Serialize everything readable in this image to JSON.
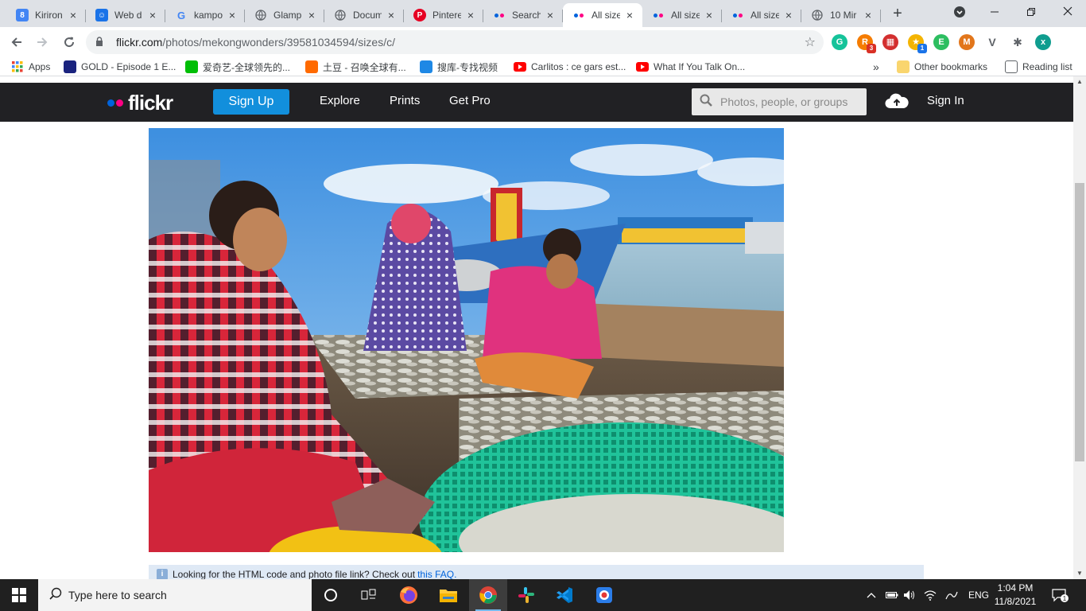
{
  "browser": {
    "tabs": [
      {
        "title": "Kiriron",
        "favicon": "google-sites-icon",
        "active": false
      },
      {
        "title": "Web d",
        "favicon": "google-contacts-icon",
        "active": false
      },
      {
        "title": "kampo",
        "favicon": "google-g-icon",
        "active": false
      },
      {
        "title": "Glamp",
        "favicon": "globe-icon",
        "active": false
      },
      {
        "title": "Docum",
        "favicon": "globe-icon",
        "active": false
      },
      {
        "title": "Pintere",
        "favicon": "pinterest-icon",
        "active": false
      },
      {
        "title": "Search",
        "favicon": "flickr-icon",
        "active": false
      },
      {
        "title": "All size",
        "favicon": "flickr-icon",
        "active": true
      },
      {
        "title": "All size",
        "favicon": "flickr-icon",
        "active": false
      },
      {
        "title": "All size",
        "favicon": "flickr-icon",
        "active": false
      },
      {
        "title": "10 Mir",
        "favicon": "globe-icon",
        "active": false
      }
    ],
    "url_host": "flickr.com",
    "url_path": "/photos/mekongwonders/39581034594/sizes/c/",
    "extensions": [
      {
        "name": "grammarly-icon",
        "color": "#15c39a",
        "label": "G",
        "badge": ""
      },
      {
        "name": "rss-extension-icon",
        "color": "#f57c00",
        "label": "R",
        "badge": "3"
      },
      {
        "name": "red-grid-extension-icon",
        "color": "#d32f2f",
        "label": "▦",
        "badge": ""
      },
      {
        "name": "star-extension-icon",
        "color": "#f4b400",
        "label": "★",
        "badge": "1"
      },
      {
        "name": "evernote-icon",
        "color": "#2dbe60",
        "label": "E",
        "badge": ""
      },
      {
        "name": "metamask-icon",
        "color": "#e2761b",
        "label": "M",
        "badge": ""
      },
      {
        "name": "vee-extension-icon",
        "color": "#5f6368",
        "label": "V",
        "badge": ""
      },
      {
        "name": "puzzle-extensions-icon",
        "color": "#5f6368",
        "label": "✱",
        "badge": ""
      },
      {
        "name": "profile-avatar-icon",
        "color": "#0f9d8f",
        "label": "x",
        "badge": ""
      }
    ],
    "bookmarks": [
      {
        "label": "Apps",
        "icon": "apps-grid-icon",
        "color": "#4285f4"
      },
      {
        "label": "GOLD - Episode 1 E...",
        "icon": "gold-bookmark-icon",
        "color": "#1a237e"
      },
      {
        "label": "爱奇艺-全球领先的...",
        "icon": "iqiyi-icon",
        "color": "#00be06"
      },
      {
        "label": "土豆 - 召唤全球有...",
        "icon": "tudou-icon",
        "color": "#ff6a00"
      },
      {
        "label": "搜库-专找视频",
        "icon": "soku-icon",
        "color": "#1e88e5"
      },
      {
        "label": "Carlitos : ce gars est...",
        "icon": "youtube-icon",
        "color": "#ff0000"
      },
      {
        "label": "What If You Talk On...",
        "icon": "youtube-icon",
        "color": "#ff0000"
      }
    ],
    "bookmarks_overflow": "»",
    "other_bookmarks": "Other bookmarks",
    "reading_list": "Reading list"
  },
  "flickr": {
    "logo": "flickr",
    "signup": "Sign Up",
    "nav": [
      "Explore",
      "Prints",
      "Get Pro"
    ],
    "search_placeholder": "Photos, people, or groups",
    "signin": "Sign In",
    "faq_text": "Looking for the HTML code and photo file link? Check out",
    "faq_link": "this FAQ."
  },
  "taskbar": {
    "search_placeholder": "Type here to search",
    "apps": [
      {
        "name": "task-view-icon",
        "open": false
      },
      {
        "name": "firefox-icon",
        "open": false
      },
      {
        "name": "file-explorer-icon",
        "open": false
      },
      {
        "name": "chrome-icon",
        "open": true
      },
      {
        "name": "slack-icon",
        "open": false
      },
      {
        "name": "vscode-icon",
        "open": false
      },
      {
        "name": "screen-recorder-icon",
        "open": false
      }
    ],
    "language": "ENG",
    "time": "1:04 PM",
    "date": "11/8/2021",
    "notification_count": "1"
  }
}
